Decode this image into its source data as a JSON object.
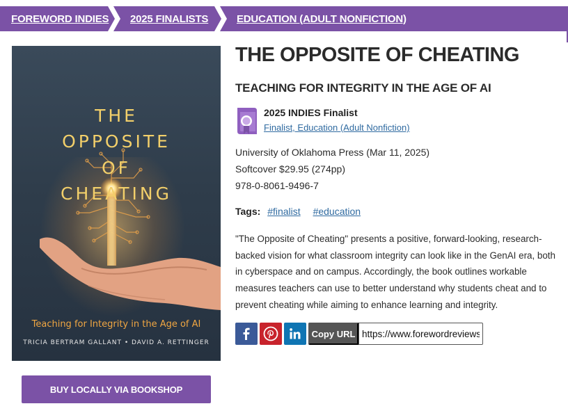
{
  "breadcrumb": {
    "items": [
      "FOREWORD INDIES",
      "2025 FINALISTS",
      "EDUCATION (ADULT NONFICTION)"
    ]
  },
  "cover": {
    "title_lines": [
      "THE",
      "OPPOSITE",
      "OF",
      "CHEATING"
    ],
    "subtitle": "Teaching for Integrity in the Age of AI",
    "authors": "TRICIA BERTRAM GALLANT • DAVID A. RETTINGER"
  },
  "buy_button": "BUY LOCALLY VIA BOOKSHOP",
  "book": {
    "title": "THE OPPOSITE OF CHEATING",
    "subtitle": "TEACHING FOR INTEGRITY IN THE AGE OF AI",
    "award": {
      "title": "2025 INDIES Finalist",
      "link": "Finalist, Education (Adult Nonfiction)",
      "icon": "award-book-icon"
    },
    "publisher": "University of Oklahoma Press (Mar 11, 2025)",
    "format": "Softcover $29.95 (274pp)",
    "isbn": "978-0-8061-9496-7",
    "tags_label": "Tags:",
    "tags": [
      "#finalist",
      "#education"
    ],
    "description": "\"The Opposite of Cheating\" presents a positive, forward-looking, research-backed vision for what classroom integrity can look like in the GenAI era, both in cyberspace and on campus. Accordingly, the book outlines workable measures teachers can use to better understand why students cheat and to prevent cheating while aiming to enhance learning and integrity."
  },
  "share": {
    "icons": [
      "facebook-icon",
      "pinterest-icon",
      "linkedin-icon"
    ],
    "copy_label": "Copy URL",
    "url_value": "https://www.forewordreviews.com"
  },
  "colors": {
    "brand_purple": "#7b52a6",
    "link_blue": "#2f6aa0",
    "facebook": "#3b5a98",
    "pinterest": "#c8232c",
    "linkedin": "#0f75b3"
  }
}
